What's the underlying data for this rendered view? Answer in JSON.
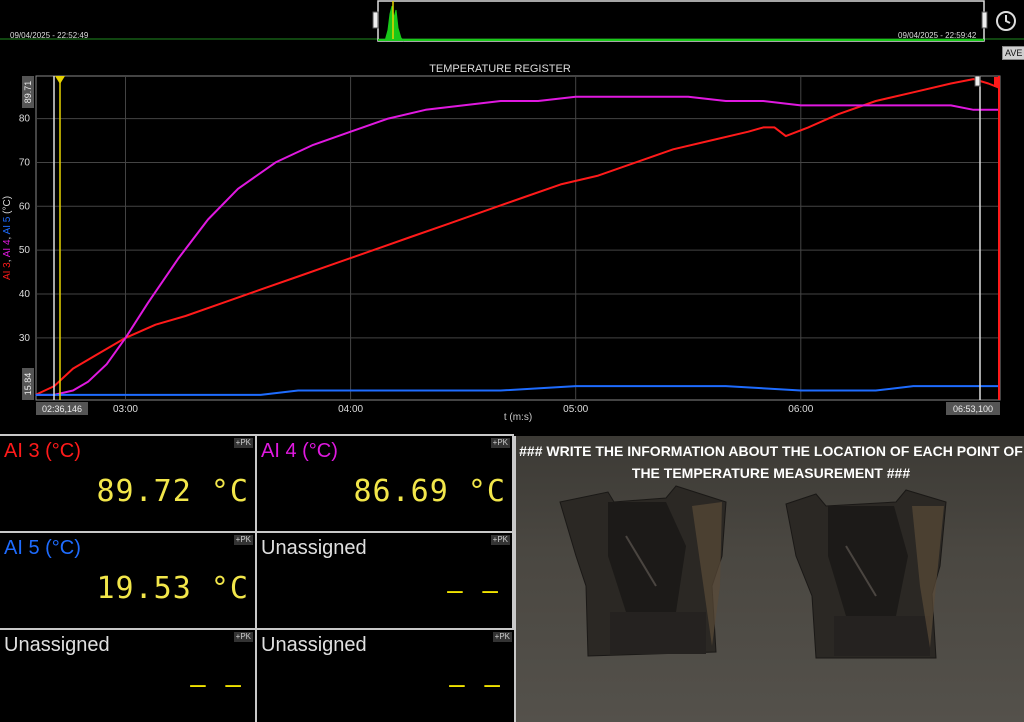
{
  "overview": {
    "start_time": "09/04/2025 - 22:52:49",
    "end_time": "09/04/2025 - 22:59:42"
  },
  "toolbar": {
    "ave_label": "AVE",
    "clock_icon": "clock-icon"
  },
  "chart_data": {
    "type": "line",
    "title": "TEMPERATURE REGISTER",
    "xlabel": "t (m:s)",
    "ylabel": "AI 3, AI 4, AI 5 (°C)",
    "ylabel_parts": [
      "AI 3",
      ", ",
      "AI 4",
      ", ",
      "AI 5",
      " (°C)"
    ],
    "ylim": [
      15.84,
      89.71
    ],
    "y_top_label": "89.71",
    "y_bottom_label": "15.84",
    "yticks": [
      30,
      40,
      50,
      60,
      70,
      80
    ],
    "x_range_s": [
      156.146,
      413.1
    ],
    "x_start_label": "02:36,146",
    "x_end_label": "06:53,100",
    "xticks": [
      {
        "s": 180,
        "label": "03:00"
      },
      {
        "s": 240,
        "label": "04:00"
      },
      {
        "s": 300,
        "label": "05:00"
      },
      {
        "s": 360,
        "label": "06:00"
      }
    ],
    "grid": true,
    "series": [
      {
        "name": "AI 3",
        "color": "#ff1a1a",
        "x": [
          156,
          161,
          166,
          172,
          180,
          188,
          196,
          206,
          216,
          226,
          236,
          246,
          256,
          266,
          276,
          286,
          296,
          306,
          316,
          326,
          336,
          346,
          350,
          353,
          356,
          362,
          370,
          380,
          390,
          400,
          406,
          410,
          413
        ],
        "y": [
          17,
          19,
          23,
          26,
          30,
          33,
          35,
          38,
          41,
          44,
          47,
          50,
          53,
          56,
          59,
          62,
          65,
          67,
          70,
          73,
          75,
          77,
          78,
          78,
          76,
          78,
          81,
          84,
          86,
          88,
          89,
          88,
          87
        ]
      },
      {
        "name": "AI 4",
        "color": "#e019e0",
        "x": [
          156,
          161,
          166,
          170,
          175,
          180,
          186,
          194,
          202,
          210,
          220,
          230,
          240,
          250,
          260,
          270,
          280,
          290,
          300,
          310,
          320,
          330,
          340,
          350,
          360,
          370,
          380,
          390,
          400,
          406,
          410,
          413
        ],
        "y": [
          17,
          17,
          18,
          20,
          24,
          30,
          38,
          48,
          57,
          64,
          70,
          74,
          77,
          80,
          82,
          83,
          84,
          84,
          85,
          85,
          85,
          85,
          84,
          84,
          83,
          83,
          83,
          83,
          83,
          82,
          82,
          82
        ]
      },
      {
        "name": "AI 5",
        "color": "#1e6cff",
        "x": [
          156,
          166,
          180,
          196,
          206,
          216,
          226,
          240,
          260,
          280,
          300,
          320,
          340,
          360,
          380,
          390,
          400,
          408,
          413
        ],
        "y": [
          17,
          17,
          17,
          17,
          17,
          17,
          18,
          18,
          18,
          18,
          19,
          19,
          19,
          18,
          18,
          19,
          19,
          19,
          19
        ]
      }
    ]
  },
  "panels": [
    {
      "label": "AI 3 (°C)",
      "color": "#ff1a1a",
      "value": "89.72 °C",
      "pk": "+PK"
    },
    {
      "label": "AI 4 (°C)",
      "color": "#e019e0",
      "value": "86.69 °C",
      "pk": "+PK"
    },
    {
      "label": "AI 5 (°C)",
      "color": "#1e6cff",
      "value": "19.53 °C",
      "pk": "+PK"
    },
    {
      "label": "Unassigned",
      "color": "#e0e0e0",
      "value": "– –",
      "pk": "+PK"
    },
    {
      "label": "Unassigned",
      "color": "#e0e0e0",
      "value": "– –",
      "pk": "+PK"
    },
    {
      "label": "Unassigned",
      "color": "#e0e0e0",
      "value": "– –",
      "pk": "+PK"
    }
  ],
  "photo": {
    "note": "### WRITE THE INFORMATION ABOUT THE LOCATION OF EACH POINT OF THE TEMPERATURE MEASUREMENT ###"
  }
}
